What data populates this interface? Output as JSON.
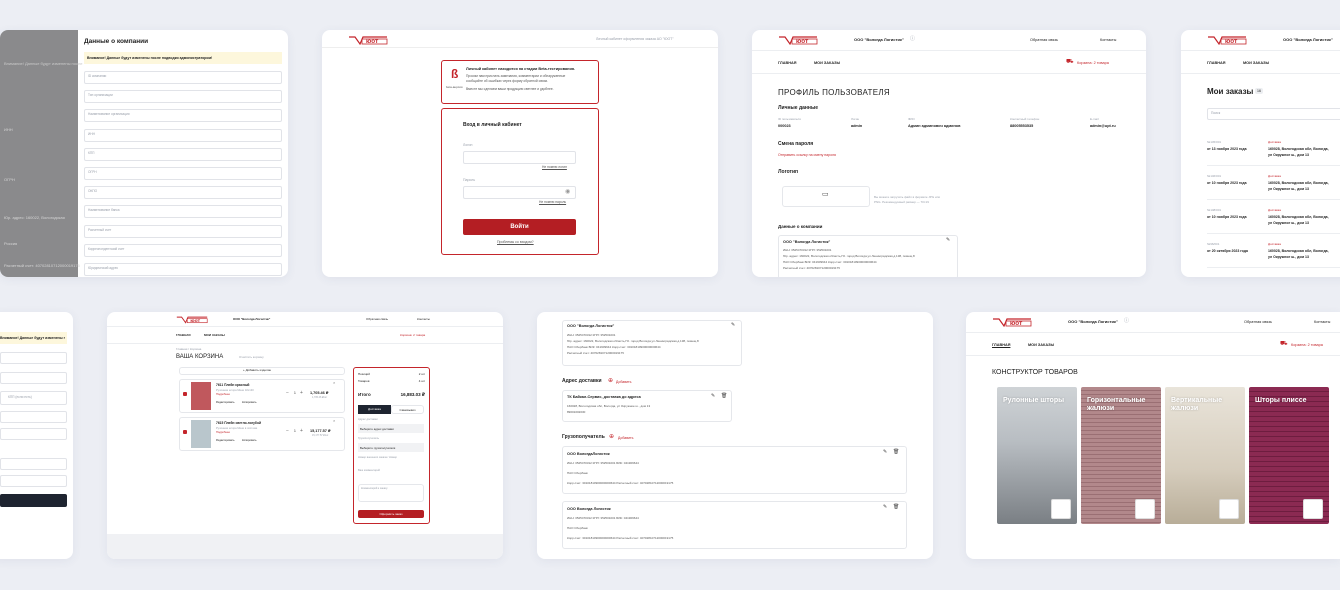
{
  "colors": {
    "brand": "#c4252b",
    "button": "#b41e23",
    "notice": "#fdf7dc",
    "page_bg": "#eceef4"
  },
  "header": {
    "company": "ООО \"Вологда Логистик\"",
    "feedback": "Обратная связь",
    "contacts": "Контакты",
    "nav_main": "ГЛАВНАЯ",
    "nav_orders": "МОИ ЗАКАЗЫ",
    "cart_2": "Корзина: 2 товара"
  },
  "company_form": {
    "title": "Данные о компании",
    "notice": "Внимание! Данные будут изменены после подводки администратором!",
    "placeholders": [
      "ID компании",
      "Тип организации",
      "Наименование организации",
      "ИНН",
      "КПП",
      "ОГРН",
      "ОКПО",
      "Наименование банка",
      "Расчетный счет",
      "Корреспондентский счет",
      "Юридический адрес"
    ]
  },
  "login": {
    "topbar": "Личный кабинет оформления заказа АО \"ЮОТ\"",
    "beta_title": "Личный кабинет находится на стадии Beta-тестирования.",
    "beta_text_1": "Просим нам прислать замечания, комментарии и обнаруженные",
    "beta_text_2": "сообщайте об ошибках через форму обратной связи.",
    "beta_text_3": "Вместе мы сделаем ваши продукцию светлее и удобнее.",
    "beta_badge": "beta-версия",
    "title": "Вход в личный кабинет",
    "login_label": "Логин",
    "forgot_login": "Не помню логин",
    "password_label": "Пароль",
    "forgot_password": "Не помню пароль",
    "submit": "Войти",
    "problem": "Проблемы со входом?"
  },
  "profile": {
    "title": "ПРОФИЛЬ ПОЛЬЗОВАТЕЛЯ",
    "personal": "Личные данные",
    "fields": [
      {
        "label": "ID пользователя",
        "value": "000023"
      },
      {
        "label": "Логин",
        "value": "admin"
      },
      {
        "label": "ФИО",
        "value": "Админ админович админов"
      },
      {
        "label": "Контактный телефон",
        "value": "88005553535"
      },
      {
        "label": "E-mail",
        "value": "admin@upt.ru"
      }
    ],
    "change_pass": "Смена пароля",
    "send_link": "Отправить ссылку на смену пароля",
    "logo": "Логотип",
    "logo_hint_1": "Вы можете загрузить файл в формате JPG или",
    "logo_hint_2": "PNG. Рекомендуемый размер — 70×19",
    "company_data": "Данные о компании",
    "company_name": "ООО \"Вологда Логистик\"",
    "inn_kpp": "ИНН: 3525470312    КПП: 352501001",
    "addr": "Юр. адрес: 160022, Вологодская область,ГО. город Вологда,ул.Ленинградская,д.138, помещ.8",
    "bank": "ПАО Сбербанк    БИК: 041909644    Корр.счет: 30101810900000000644",
    "acc": "Расчетный счет: 40702810712000019175"
  },
  "orders": {
    "title": "Мои заказы",
    "badge": "16",
    "search": "Поиск",
    "status": "Доставка",
    "rows": [
      {
        "num": "№145/001",
        "date": "от 13 ноября 2023 года",
        "addr1": "160028, Вологодская обл, Вологда,",
        "addr2": "ул Окружное ш., дом 13"
      },
      {
        "num": "№146/001",
        "date": "от 10 ноября 2023 года",
        "addr1": "160028, Вологодская обл, Вологда,",
        "addr2": "ул Окружное ш., дом 13"
      },
      {
        "num": "№148/001",
        "date": "от 10 ноября 2023 года",
        "addr1": "160028, Вологодская обл, Вологда,",
        "addr2": "ул Окружное ш., дом 13"
      },
      {
        "num": "№96/001",
        "date": "от 20 октября 2023 года",
        "addr1": "160028, Вологодская обл, Вологда,",
        "addr2": "ул Окружное ш., дом 13"
      }
    ]
  },
  "cart": {
    "crumb": "Главная  /  Корзина",
    "title": "ВАША КОРЗИНА",
    "clear": "Очистить корзину",
    "add_item": "+ Добавить изделие",
    "items": [
      {
        "name": "7611 Плейн красный",
        "sub": "Рулонная штора Мини 32х130",
        "link": "Подробнее",
        "edit": "Редактировать",
        "copy": "Копировать",
        "qty": "1",
        "price": "1,705.46 ₽",
        "old": "1,705.46 ₽/шт"
      },
      {
        "name": "7615 Плейн светло-голубой",
        "sub": "Рулонная штора Мини в системе",
        "link": "Подробнее",
        "edit": "Редактировать",
        "copy": "Копировать",
        "qty": "1",
        "price": "15,177.57 ₽",
        "old": "15,177.57 ₽/шт"
      }
    ],
    "summary": {
      "pos_label": "Позиций",
      "pos_val": "2 шт",
      "goods_label": "Товаров",
      "goods_val": "4 шт",
      "total_label": "Итого",
      "total_val": "16,883.03 ₽",
      "tab_delivery": "Доставка",
      "tab_pickup": "Самовывоз",
      "addr_label": "Адрес доставки",
      "addr_select": "Выберите адрес доставки",
      "cons_label": "Грузополучатель",
      "cons_select": "Выберите грузополучателя",
      "note_1": "Номер внешнего заказа / Номер",
      "note_2": "Ваш комментарий",
      "comment": "Комментарий к заказу",
      "submit": "Оформить заказ"
    }
  },
  "consignee": {
    "company_name": "ООО \"Вологда Логистик\"",
    "inn_kpp": "ИНН: 3525470312    КПП: 352501001",
    "addr": "Юр. адрес: 160022, Вологодская область,ГО. город Вологда,ул.Ленинградская,д.138, помещ.8",
    "bank": "ПАО Сбербанк    БИК: 041909644    Корр.счет: 30101810900000000644",
    "acc": "Расчетный счет: 40702810712000019175",
    "delivery_title": "Адрес доставки",
    "add": "Добавить",
    "delivery_name": "ТК Байкал-Сервис, доставка до адреса",
    "delivery_addr": "160028, Вологодская обл, Вологда, ул Окружное ш., дом 13",
    "delivery_phone": "89001002030",
    "cons_title": "Грузополучатель",
    "cons": [
      {
        "name": "ООО ВологдаЛогистик",
        "inn": "ИНН: 3525470312    КПП: 352501001    БИК: 041909644",
        "bank": "ПАО Сбербанк",
        "acc": "Корр.счет: 30101810900000000644    Расчетный счет: 40702810712000019175"
      },
      {
        "name": "ООО Вологда Логистик",
        "inn": "ИНН: 3525470312    КПП: 352501001    БИК: 041909644",
        "bank": "ПАО Сбербанк",
        "acc": "Корр.счет: 30101810900000000644    Расчетный счет: 40702810712000019175"
      }
    ]
  },
  "constructor": {
    "title": "КОНСТРУКТОР ТОВАРОВ",
    "tiles": [
      "Рулонные шторы",
      "Горизонтальные жалюзи",
      "Вертикальные жалюзи",
      "Шторы плиссе"
    ]
  },
  "left_form": {
    "notice": "Внимание! Данные будут изменены после подводки администратором!",
    "kpp": "КПП (если есть)"
  },
  "left_edge": {
    "text1": "Внимание! Данные будут изменены после",
    "text2": "ИНН",
    "text3": "ОГРН",
    "text4": "Юр. адрес: 160022, Вологодская",
    "text5": "Россия",
    "text6": "Расчетный счет: 40702810712000019175"
  }
}
